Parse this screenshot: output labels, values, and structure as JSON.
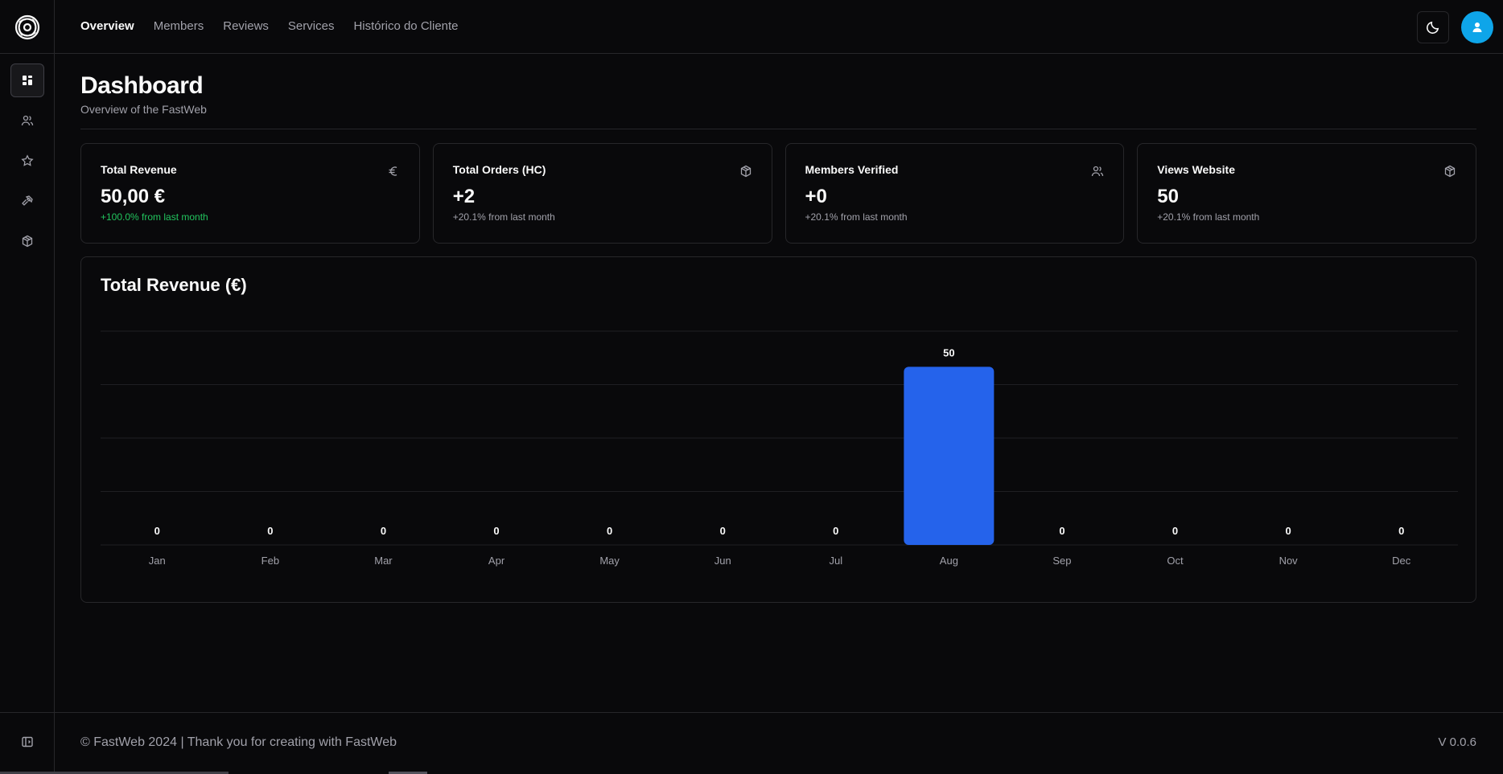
{
  "nav": {
    "items": [
      {
        "label": "Overview",
        "active": true
      },
      {
        "label": "Members"
      },
      {
        "label": "Reviews"
      },
      {
        "label": "Services"
      },
      {
        "label": "Histórico do Cliente"
      }
    ]
  },
  "sidebar": {
    "icons": [
      "dashboard-icon",
      "users-icon",
      "star-icon",
      "hammer-icon",
      "package-icon"
    ],
    "collapse_icon": "sidebar-toggle-icon"
  },
  "header": {
    "title": "Dashboard",
    "subtitle": "Overview of the FastWeb"
  },
  "cards": [
    {
      "title": "Total Revenue",
      "value": "50,00 €",
      "note": "+100.0% from last month",
      "icon": "euro-icon",
      "positive": true
    },
    {
      "title": "Total Orders (HC)",
      "value": "+2",
      "note": "+20.1% from last month",
      "icon": "package-icon"
    },
    {
      "title": "Members Verified",
      "value": "+0",
      "note": "+20.1% from last month",
      "icon": "users-icon"
    },
    {
      "title": "Views Website",
      "value": "50",
      "note": "+20.1% from last month",
      "icon": "package-icon"
    }
  ],
  "chart_data": {
    "type": "bar",
    "title": "Total Revenue (€)",
    "categories": [
      "Jan",
      "Feb",
      "Mar",
      "Apr",
      "May",
      "Jun",
      "Jul",
      "Aug",
      "Sep",
      "Oct",
      "Nov",
      "Dec"
    ],
    "values": [
      0,
      0,
      0,
      0,
      0,
      0,
      0,
      50,
      0,
      0,
      0,
      0
    ],
    "ylim": [
      0,
      60
    ],
    "grid": true,
    "bar_color": "#2563eb"
  },
  "footer": {
    "text": "© FastWeb 2024 | Thank you for creating with FastWeb",
    "version": "V 0.0.6"
  },
  "colors": {
    "accent": "#0ea5e9",
    "positive": "#22c55e",
    "background": "#09090b"
  }
}
